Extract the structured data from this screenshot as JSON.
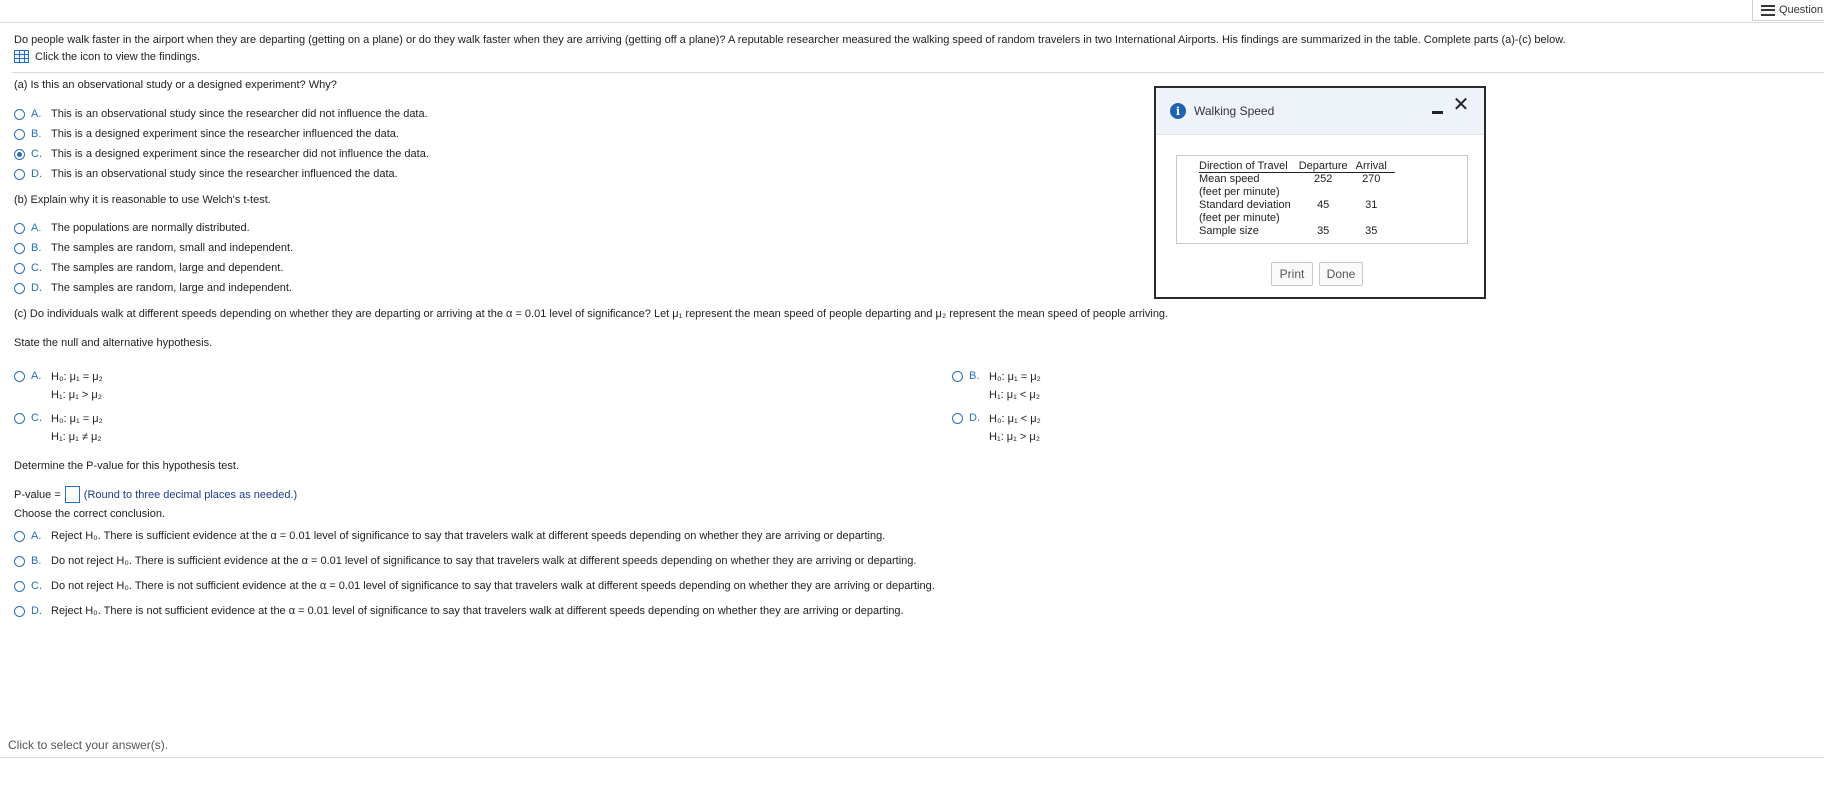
{
  "header": {
    "questions_label": "Question"
  },
  "intro": {
    "text": "Do people walk faster in the airport when they are departing (getting on a plane) or do they walk faster when they are arriving (getting off a plane)? A reputable researcher measured the walking speed of random travelers in two International Airports. His findings are summarized in the table. Complete parts (a)-(c) below.",
    "view_link": "Click the icon to view the findings."
  },
  "part_a": {
    "question": "(a) Is this an observational study or a designed experiment? Why?",
    "options": [
      {
        "letter": "A.",
        "text": "This is an observational study since the researcher did not influence the data."
      },
      {
        "letter": "B.",
        "text": "This is a designed experiment since the researcher influenced the data."
      },
      {
        "letter": "C.",
        "text": "This is a designed experiment since the researcher did not influence the data."
      },
      {
        "letter": "D.",
        "text": "This is an observational study since the researcher influenced the data."
      }
    ],
    "selected": "C"
  },
  "part_b": {
    "question": "(b) Explain why it is reasonable to use Welch's t-test.",
    "options": [
      {
        "letter": "A.",
        "text": "The populations are normally distributed."
      },
      {
        "letter": "B.",
        "text": "The samples are random, small and independent."
      },
      {
        "letter": "C.",
        "text": "The samples are random, large and dependent."
      },
      {
        "letter": "D.",
        "text": "The samples are random, large and independent."
      }
    ]
  },
  "part_c": {
    "question": "(c) Do individuals walk at different speeds depending on whether they are departing or arriving at the α = 0.01 level of significance? Let μ₁ represent the mean speed of people departing and μ₂ represent the mean speed of people arriving.",
    "state_hyp": "State the null and alternative hypothesis.",
    "hyp_options": [
      {
        "letter": "A.",
        "h0": "H₀: μ₁ = μ₂",
        "h1": "H₁: μ₁ > μ₂"
      },
      {
        "letter": "B.",
        "h0": "H₀: μ₁ = μ₂",
        "h1": "H₁: μ₁ < μ₂"
      },
      {
        "letter": "C.",
        "h0": "H₀: μ₁ = μ₂",
        "h1": "H₁: μ₁ ≠ μ₂"
      },
      {
        "letter": "D.",
        "h0": "H₀: μ₁ < μ₂",
        "h1": "H₁: μ₁ > μ₂"
      }
    ],
    "pvalue_prompt": "Determine the P-value for this hypothesis test.",
    "pvalue_label": "P-value =",
    "pvalue_value": "",
    "pvalue_hint": "(Round to three decimal places as needed.)",
    "conclusion_prompt": "Choose the correct conclusion.",
    "conclusions": [
      {
        "letter": "A.",
        "text": "Reject H₀. There is sufficient evidence at the α = 0.01 level of significance to say that travelers walk at different speeds depending on whether they are arriving or departing."
      },
      {
        "letter": "B.",
        "text": "Do not reject H₀. There is sufficient evidence at the α = 0.01 level of significance to say that travelers walk at different speeds depending on whether they are arriving or departing."
      },
      {
        "letter": "C.",
        "text": "Do not reject H₀. There is not sufficient evidence at the α = 0.01 level of significance to say that travelers walk at different speeds depending on whether they are arriving or departing."
      },
      {
        "letter": "D.",
        "text": "Reject H₀. There is not sufficient evidence at the α = 0.01 level of significance to say that travelers walk at different speeds depending on whether they are arriving or departing."
      }
    ]
  },
  "footer": {
    "text": "Click to select your answer(s)."
  },
  "dialog": {
    "title": "Walking Speed",
    "table": {
      "headers": [
        "Direction of Travel",
        "Departure",
        "Arrival"
      ],
      "rows": [
        {
          "label1": "Mean speed",
          "label2": "(feet per minute)",
          "departure": "252",
          "arrival": "270"
        },
        {
          "label1": "Standard deviation",
          "label2": "(feet per minute)",
          "departure": "45",
          "arrival": "31"
        },
        {
          "label1": "Sample size",
          "label2": "",
          "departure": "35",
          "arrival": "35"
        }
      ]
    },
    "print_label": "Print",
    "done_label": "Done"
  },
  "colors": {
    "accent": "#2a6ebb",
    "hint": "#1a3c8c",
    "dialog_header": "#eef3fa"
  }
}
